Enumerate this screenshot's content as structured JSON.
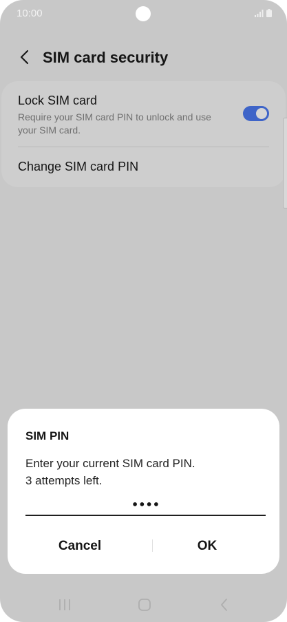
{
  "status_bar": {
    "time": "10:00",
    "icons": [
      "signal-icon",
      "battery-icon"
    ]
  },
  "header": {
    "back_icon": "chevron-left-icon",
    "title": "SIM card security"
  },
  "settings": {
    "lock_sim": {
      "title": "Lock SIM card",
      "description": "Require your SIM card PIN to unlock and use your SIM card.",
      "enabled": true
    },
    "change_pin": {
      "label": "Change SIM card PIN"
    }
  },
  "dialog": {
    "title": "SIM PIN",
    "message_line1": "Enter your current SIM card PIN.",
    "message_line2": "3 attempts left.",
    "pin_value": "••••",
    "cancel_label": "Cancel",
    "ok_label": "OK"
  },
  "nav_bar": {
    "items": [
      "recents-icon",
      "home-icon",
      "back-icon"
    ]
  },
  "colors": {
    "background": "#c8c8c8",
    "accent": "#3e64c8",
    "dialog": "#ffffff"
  }
}
